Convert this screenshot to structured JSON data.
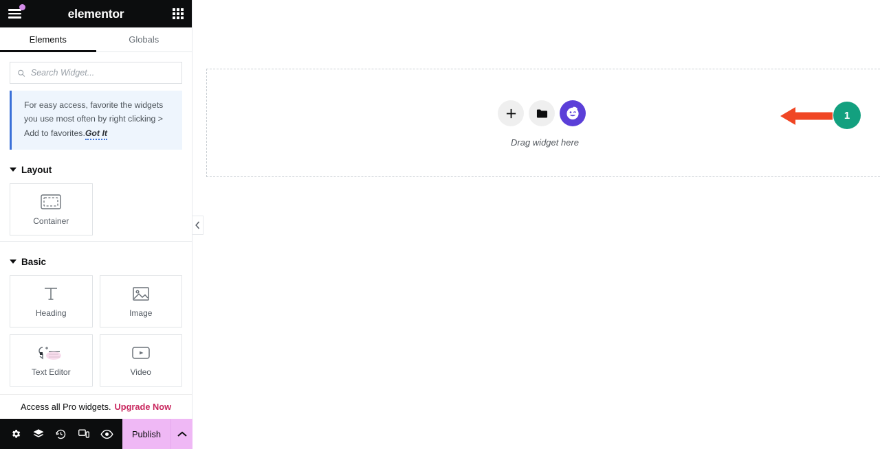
{
  "header": {
    "brand": "elementor",
    "menu_icon": "hamburger-menu-icon",
    "apps_icon": "apps-grid-icon",
    "notification_dot_color": "#d58ce9"
  },
  "tabs": [
    {
      "label": "Elements",
      "active": true
    },
    {
      "label": "Globals",
      "active": false
    }
  ],
  "search": {
    "placeholder": "Search Widget...",
    "value": "",
    "icon": "search-icon"
  },
  "notice": {
    "text": "For easy access, favorite the widgets you use most often by right clicking > Add to favorites.",
    "action_label": "Got It",
    "accent_color": "#3a70d8",
    "background": "#eef5fd"
  },
  "sections": [
    {
      "title": "Layout",
      "collapsed": false,
      "widgets": [
        {
          "label": "Container",
          "icon": "container-icon"
        }
      ]
    },
    {
      "title": "Basic",
      "collapsed": false,
      "widgets": [
        {
          "label": "Heading",
          "icon": "heading-text-icon"
        },
        {
          "label": "Image",
          "icon": "image-picture-icon"
        },
        {
          "label": "Text Editor",
          "icon": "text-editor-icon"
        },
        {
          "label": "Video",
          "icon": "video-play-icon"
        }
      ]
    }
  ],
  "pro_bar": {
    "text": "Access all Pro widgets.",
    "link_label": "Upgrade Now",
    "link_color": "#c9285f"
  },
  "bottom_bar": {
    "icons": [
      {
        "name": "settings-gear-icon",
        "label": "Settings"
      },
      {
        "name": "navigator-layers-icon",
        "label": "Navigator"
      },
      {
        "name": "history-clock-icon",
        "label": "History"
      },
      {
        "name": "responsive-devices-icon",
        "label": "Responsive Mode"
      },
      {
        "name": "preview-eye-icon",
        "label": "Preview Changes"
      }
    ],
    "publish_label": "Publish",
    "publish_bg": "#efb8f5",
    "publish_caret_icon": "chevron-up-icon"
  },
  "panel_collapse": {
    "icon": "chevron-left-icon"
  },
  "canvas": {
    "drop_hint": "Drag widget here",
    "buttons": [
      {
        "name": "add-element-button",
        "icon": "plus-icon"
      },
      {
        "name": "add-template-button",
        "icon": "folder-icon"
      },
      {
        "name": "ai-assistant-button",
        "icon": "ai-face-icon",
        "color": "#5b3fd8"
      }
    ]
  },
  "annotation": {
    "step_number": "1",
    "arrow_color": "#f04624",
    "badge_color": "#13a07f"
  }
}
